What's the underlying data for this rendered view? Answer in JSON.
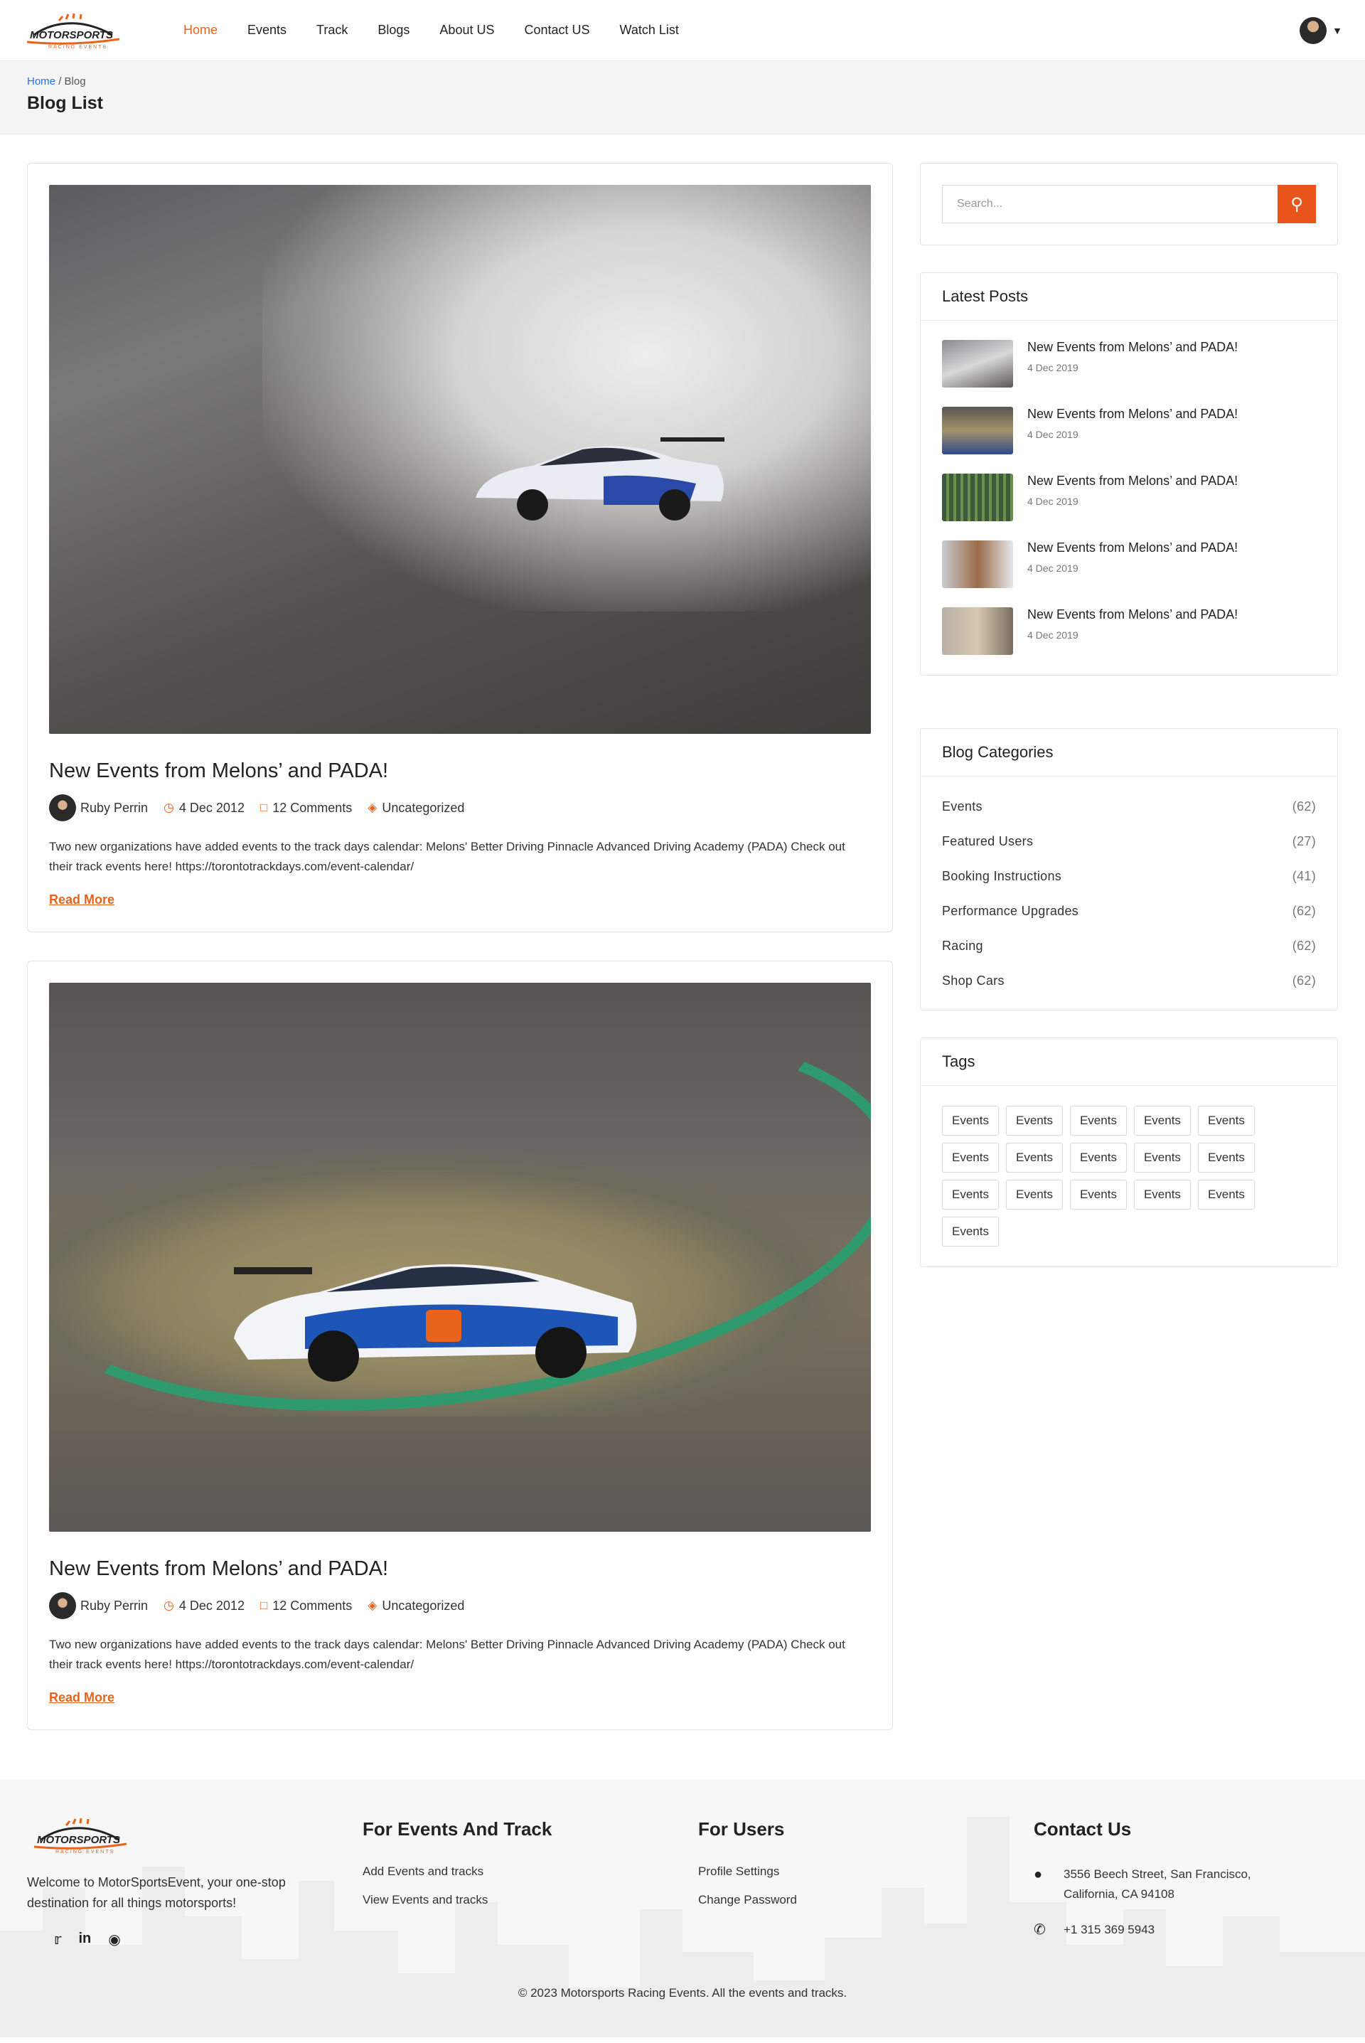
{
  "brand": {
    "name": "MOTORSPORTS",
    "tagline": "RACING EVENTS"
  },
  "nav": {
    "items": [
      {
        "label": "Home",
        "active": true
      },
      {
        "label": "Events"
      },
      {
        "label": "Track"
      },
      {
        "label": "Blogs"
      },
      {
        "label": "About US"
      },
      {
        "label": "Contact US"
      },
      {
        "label": "Watch List"
      }
    ]
  },
  "breadcrumb": {
    "home": "Home",
    "separator": "/",
    "current": "Blog"
  },
  "page": {
    "title": "Blog List"
  },
  "posts": [
    {
      "title": "New Events from Melons’ and PADA!",
      "author": "Ruby Perrin",
      "date": "4 Dec 2012",
      "comments": "12 Comments",
      "category": "Uncategorized",
      "excerpt": "Two new organizations have added events to the track days calendar: Melons' Better Driving Pinnacle Advanced Driving Academy (PADA) Check out their track events here! https://torontotrackdays.com/event-calendar/",
      "read_more": "Read More"
    },
    {
      "title": "New Events from Melons’ and PADA!",
      "author": "Ruby Perrin",
      "date": "4 Dec 2012",
      "comments": "12 Comments",
      "category": "Uncategorized",
      "excerpt": "Two new organizations have added events to the track days calendar: Melons' Better Driving Pinnacle Advanced Driving Academy (PADA) Check out their track events here! https://torontotrackdays.com/event-calendar/",
      "read_more": "Read More"
    }
  ],
  "sidebar": {
    "search": {
      "placeholder": "Search..."
    },
    "latest": {
      "title": "Latest Posts",
      "items": [
        {
          "title": "New Events from Melons’ and PADA!",
          "date": "4 Dec 2019"
        },
        {
          "title": "New Events from Melons’ and PADA!",
          "date": "4 Dec 2019"
        },
        {
          "title": "New Events from Melons’ and PADA!",
          "date": "4 Dec 2019"
        },
        {
          "title": "New Events from Melons’ and PADA!",
          "date": "4 Dec 2019"
        },
        {
          "title": "New Events from Melons’ and PADA!",
          "date": "4 Dec 2019"
        }
      ]
    },
    "categories": {
      "title": "Blog Categories",
      "items": [
        {
          "name": "Events",
          "count": "(62)"
        },
        {
          "name": "Featured Users",
          "count": "(27)"
        },
        {
          "name": "Booking Instructions",
          "count": "(41)"
        },
        {
          "name": "Performance Upgrades",
          "count": "(62)"
        },
        {
          "name": "Racing",
          "count": "(62)"
        },
        {
          "name": "Shop Cars",
          "count": "(62)"
        }
      ]
    },
    "tags": {
      "title": "Tags",
      "items": [
        "Events",
        "Events",
        "Events",
        "Events",
        "Events",
        "Events",
        "Events",
        "Events",
        "Events",
        "Events",
        "Events",
        "Events",
        "Events",
        "Events",
        "Events",
        "Events"
      ]
    }
  },
  "footer": {
    "about": "Welcome to MotorSportsEvent, your one-stop destination for all things motorsports!",
    "col1": {
      "title": "For Events And Track",
      "links": [
        "Add Events and tracks",
        "View Events and tracks"
      ]
    },
    "col2": {
      "title": "For Users",
      "links": [
        "Profile Settings",
        "Change Password"
      ]
    },
    "contact": {
      "title": "Contact Us",
      "address": "3556 Beech Street, San Francisco, California, CA 94108",
      "phone": "+1 315 369 5943"
    },
    "copyright": "© 2023 Motorsports Racing Events. All the events and tracks."
  },
  "colors": {
    "accent": "#e8641c",
    "link": "#1a73e8"
  }
}
